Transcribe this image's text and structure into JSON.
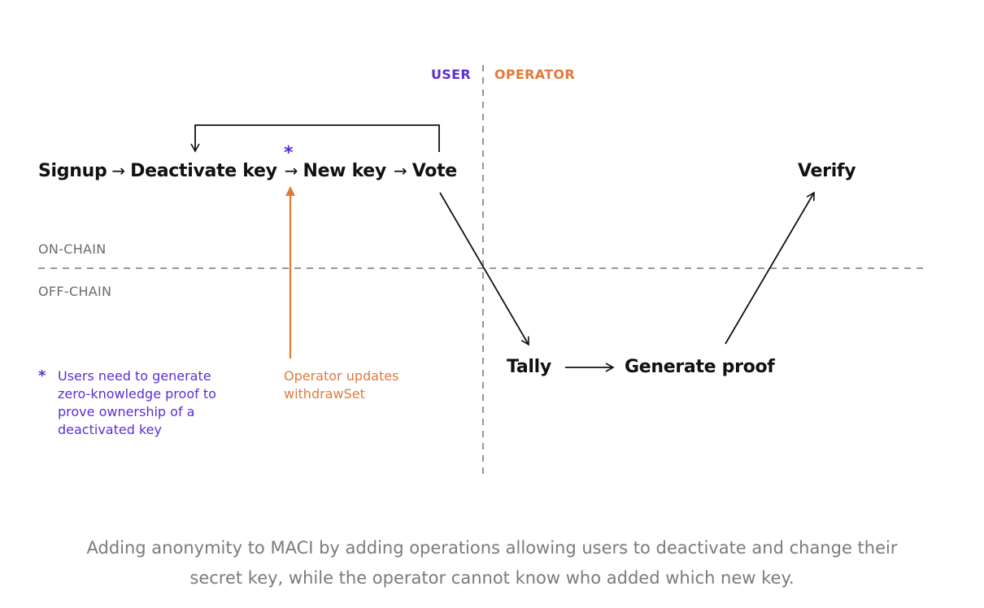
{
  "lanes": {
    "user": "USER",
    "operator": "OPERATOR"
  },
  "zones": {
    "on_chain": "ON-CHAIN",
    "off_chain": "OFF-CHAIN"
  },
  "flow": {
    "signup": "Signup",
    "deactivate_key": "Deactivate key",
    "new_key": "New key",
    "vote": "Vote",
    "arrow": "→",
    "asterisk": "*"
  },
  "operator_flow": {
    "tally": "Tally",
    "generate_proof": "Generate proof",
    "verify": "Verify"
  },
  "notes": {
    "user_note": {
      "marker": "*",
      "lines": [
        "Users need to generate",
        "zero-knowledge proof to",
        "prove ownership of a",
        "deactivated key"
      ]
    },
    "operator_note": {
      "lines": [
        "Operator updates",
        "withdrawSet"
      ]
    }
  },
  "caption": {
    "lines": [
      "Adding anonymity to MACI by adding operations allowing users to deactivate and change their",
      "secret key, while the operator cannot know who added which new key."
    ]
  },
  "colors": {
    "user_accent": "#5b2fd1",
    "operator_accent": "#e07a3a",
    "divider": "#8a8a8f",
    "text": "#111111",
    "caption": "#7a7a80"
  }
}
